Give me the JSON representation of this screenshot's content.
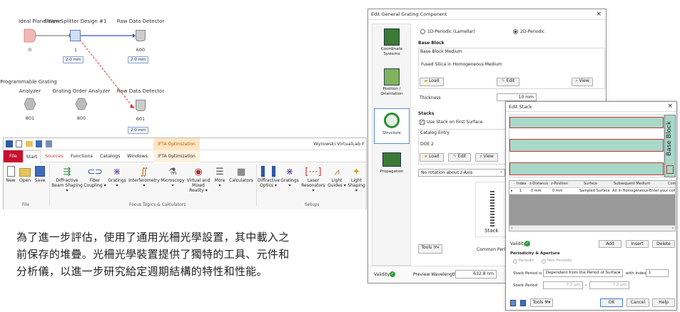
{
  "diagram": {
    "nodes": [
      {
        "title": "Ideal Plane Wave",
        "id": "0"
      },
      {
        "title": "Beam Splitter Design #1",
        "id": "1",
        "dim": "2:0 mm"
      },
      {
        "title": "Raw Data Detector",
        "id": "600",
        "dim": "2:0 mm"
      },
      {
        "title": "Programmable Grating",
        "title2": "Analyzer",
        "id": "801"
      },
      {
        "title": "Grating Order Analyzer",
        "id": "800"
      },
      {
        "title": "Raw Data Detector",
        "id": "601",
        "dim": "2:0 mm"
      }
    ]
  },
  "ribbon": {
    "context_tab": "IFTA Optimization",
    "app_title": "Wyrowski VirtualLab F",
    "tabs": [
      "File",
      "Start",
      "Sources",
      "Functions",
      "Catalogs",
      "Windows",
      "IFTA Optimization"
    ],
    "buttons": [
      {
        "l1": "New",
        "l2": ""
      },
      {
        "l1": "Open",
        "l2": ""
      },
      {
        "l1": "Save",
        "l2": ""
      },
      {
        "l1": "Diffractive",
        "l2": "Beam Shaping ▾"
      },
      {
        "l1": "Fiber",
        "l2": "Coupling ▾"
      },
      {
        "l1": "Gratings",
        "l2": "▾"
      },
      {
        "l1": "Interferometry",
        "l2": "▾"
      },
      {
        "l1": "Microscopy",
        "l2": "▾"
      },
      {
        "l1": "Virtual and",
        "l2": "Mixed Reality ▾"
      },
      {
        "l1": "More",
        "l2": "▾"
      },
      {
        "l1": "Calculators",
        "l2": ""
      },
      {
        "l1": "Diffractive",
        "l2": "Optics ▾"
      },
      {
        "l1": "Gratings",
        "l2": "▾"
      },
      {
        "l1": "Laser",
        "l2": "Resonators ▾"
      },
      {
        "l1": "Light",
        "l2": "Guides ▾"
      },
      {
        "l1": "Light",
        "l2": "Shaping ▾"
      }
    ],
    "groups": [
      "File",
      "Focus Topics & Calculators",
      "Setups"
    ]
  },
  "caption": [
    "為了進一步評估，使用了通用光柵光學設置，其中載入之",
    "前保存的堆疊。光柵光學裝置提供了獨特的工具、元件和",
    "分析儀，以進一步研究給定週期結構的特性和性能。"
  ],
  "egc": {
    "title": "Edit General Grating Component",
    "close": "×",
    "sidebar": [
      "Coordinate Systems",
      "Position / Orientation",
      "Structure",
      "Propagation"
    ],
    "radio1": "1D-Periodic (Lamellar)",
    "radio2": "2D-Periodic",
    "base_block": "Base Block",
    "base_block_medium": "Base Block Medium",
    "medium_value": "Fused Silica in Homogeneous Medium",
    "load": "Load",
    "edit": "Edit",
    "view": "View",
    "thickness_label": "Thickness",
    "thickness_value": "10 mm",
    "stacks": "Stacks",
    "use_stack": "Use Stack on First Surface",
    "catalog_entry": "Catalog Entry",
    "doe": "DOE 2",
    "rotation": "No rotation about z-Axis",
    "stack_label": "Stack",
    "tools": "Tools",
    "common_period": "Common Period",
    "validity": "Validity:",
    "preview_label": "Preview Wavelength",
    "preview_value": "632.8 nm"
  },
  "es": {
    "title": "Edit Stack",
    "close": "×",
    "side_label": "Base Block",
    "columns": [
      "Index",
      "z-Distance",
      "z-Position",
      "Surface",
      "Subsequent Medium",
      "Com"
    ],
    "row": [
      "1",
      "0 mm",
      "0 mm",
      "Sampled Surface",
      "Air in Homogeneous F",
      "Enter your comme"
    ],
    "validity": "Validity:",
    "add": "Add",
    "insert": "Insert",
    "delete": "Delete",
    "pa_title": "Periodicity & Aperture",
    "periodic": "Periodic",
    "non_periodic": "Non-Periodic",
    "stack_period_is": "Stack Period is",
    "stack_period_mode": "Dependent from the Period of Surface",
    "with_index": "with Index",
    "index_value": "1",
    "stack_period": "Stack Period",
    "period_x": "7.2 µm",
    "times": "×",
    "period_y": "7.2 µm",
    "tools": "Tools",
    "ok": "OK",
    "cancel": "Cancel",
    "help": "Help"
  }
}
